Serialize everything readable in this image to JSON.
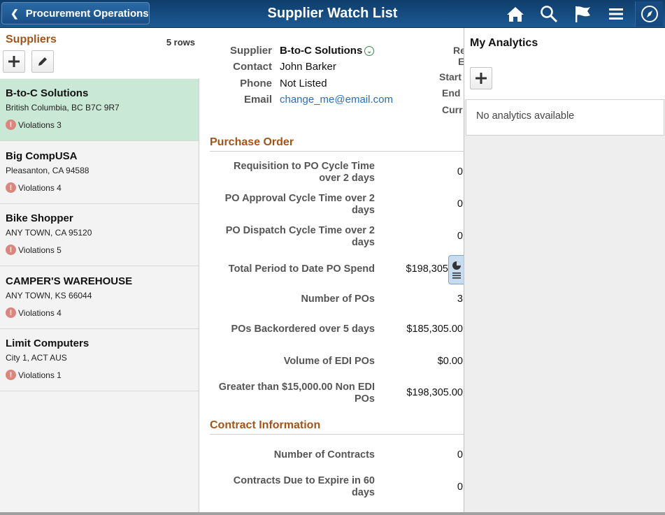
{
  "header": {
    "back_label": "Procurement Operations",
    "title": "Supplier Watch List"
  },
  "left": {
    "title": "Suppliers",
    "rows": "5 rows",
    "items": [
      {
        "name": "B-to-C Solutions",
        "address": "British Columbia, BC  B7C 9R7",
        "violations": "Violations 3"
      },
      {
        "name": "Big CompUSA",
        "address": "Pleasanton, CA  94588",
        "violations": "Violations 4"
      },
      {
        "name": "Bike Shopper",
        "address": "ANY TOWN, CA  95120",
        "violations": "Violations 5"
      },
      {
        "name": "CAMPER'S WAREHOUSE",
        "address": "ANY TOWN, KS  66044",
        "violations": "Violations 4"
      },
      {
        "name": "Limit Computers",
        "address": "City 1, ACT  AUS",
        "violations": "Violations 1"
      }
    ]
  },
  "detail": {
    "supplier_label": "Supplier",
    "supplier_value": "B-to-C Solutions",
    "contact_label": "Contact",
    "contact_value": "John Barker",
    "phone_label": "Phone",
    "phone_value": "Not Listed",
    "email_label": "Email",
    "email_value": "change_me@email.com",
    "cut_labels": [
      "Re",
      "E",
      "Start",
      "End",
      "Curr"
    ]
  },
  "purchase_order": {
    "title": "Purchase Order",
    "metrics": [
      {
        "label": "Requisition to PO Cycle Time over 2 days",
        "value": "0"
      },
      {
        "label": "PO Approval Cycle Time over 2 days",
        "value": "0"
      },
      {
        "label": "PO Dispatch Cycle Time over 2 days",
        "value": "0"
      },
      {
        "label": "Total Period to Date PO Spend",
        "value": "$198,305"
      },
      {
        "label": "Number of POs",
        "value": "3"
      },
      {
        "label": "POs Backordered over 5 days",
        "value": "$185,305.00"
      },
      {
        "label": "Volume of EDI POs",
        "value": "$0.00"
      },
      {
        "label": "Greater than $15,000.00 Non EDI POs",
        "value": "$198,305.00"
      }
    ]
  },
  "contract": {
    "title": "Contract Information",
    "metrics": [
      {
        "label": "Number of Contracts",
        "value": "0"
      },
      {
        "label": "Contracts Due to Expire in 60 days",
        "value": "0"
      }
    ]
  },
  "analytics": {
    "title": "My Analytics",
    "empty": "No analytics available"
  }
}
